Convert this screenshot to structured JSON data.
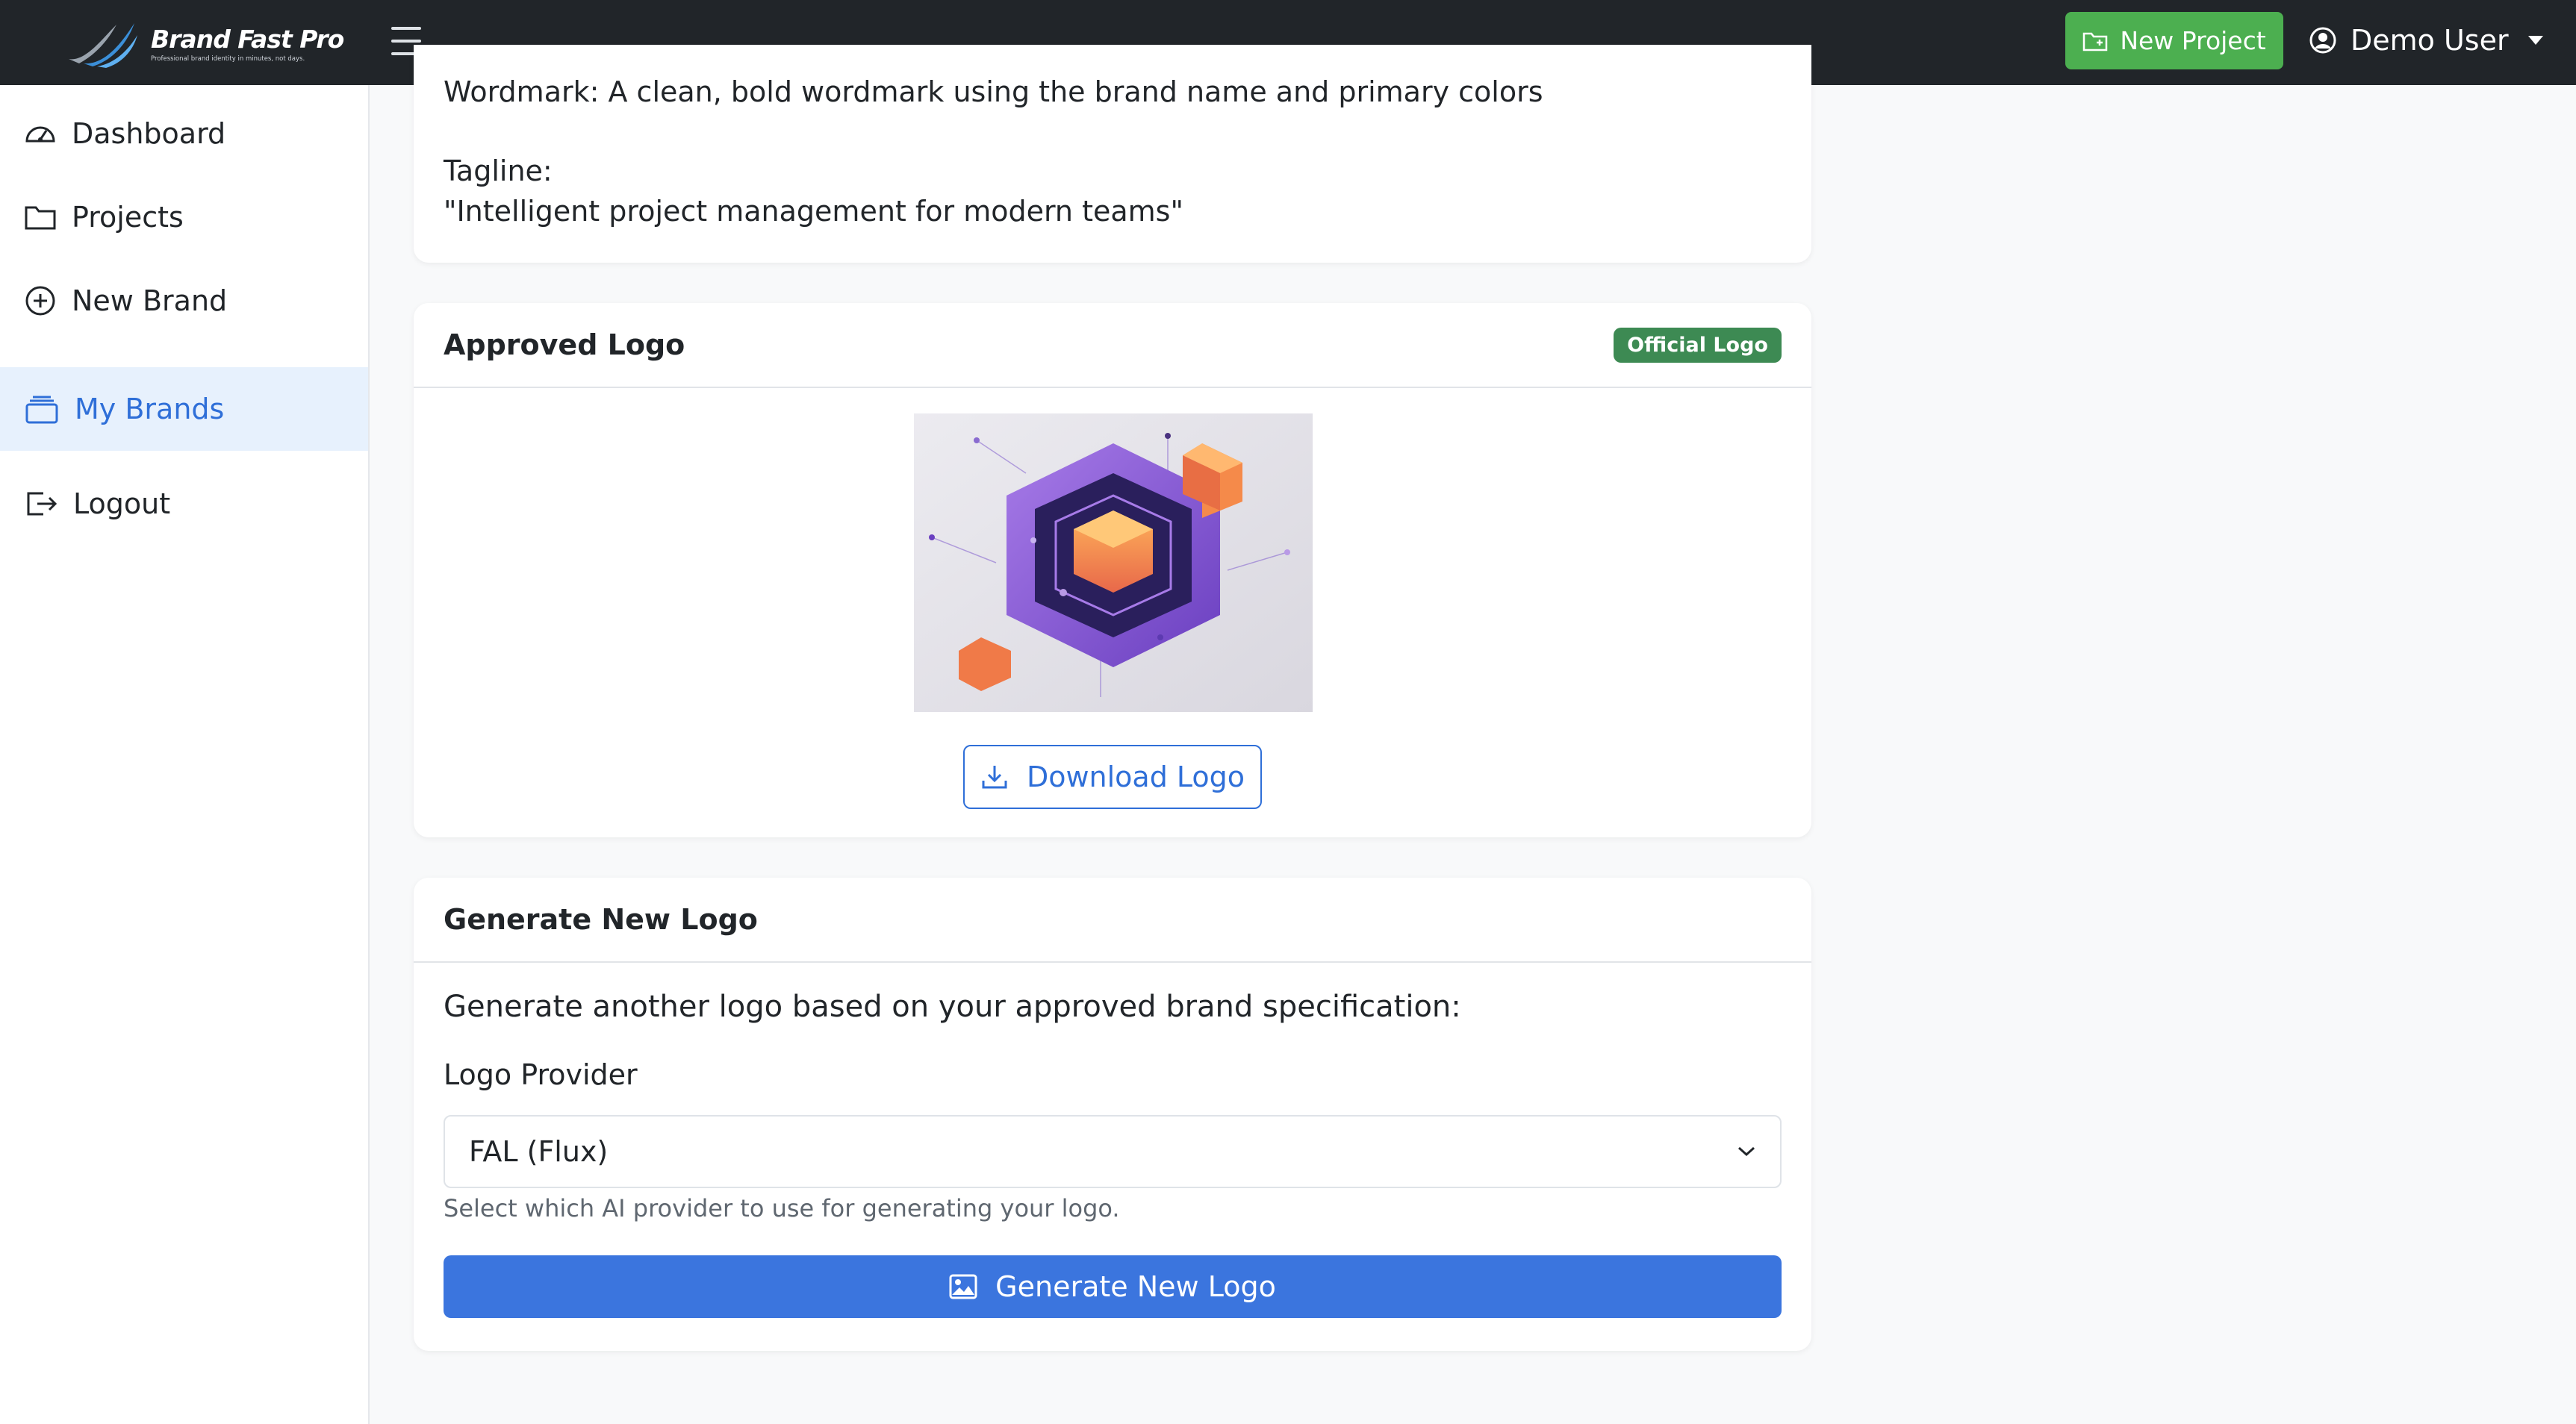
{
  "app": {
    "brand_name": "Brand Fast Pro",
    "brand_tagline": "Professional brand identity in minutes, not days."
  },
  "header": {
    "new_project_label": "New Project",
    "user_name": "Demo User",
    "new_project_color": "#4caf50"
  },
  "sidebar": {
    "items": [
      {
        "label": "Dashboard",
        "icon": "speedometer-icon"
      },
      {
        "label": "Projects",
        "icon": "folder-icon"
      },
      {
        "label": "New Brand",
        "icon": "plus-circle-icon"
      },
      {
        "label": "My Brands",
        "icon": "collection-icon",
        "active": true
      },
      {
        "label": "Logout",
        "icon": "logout-icon"
      }
    ]
  },
  "spec_card": {
    "wordmark_line": "Wordmark: A clean, bold wordmark using the brand name and primary colors",
    "tagline_label": "Tagline:",
    "tagline_value": "\"Intelligent project management for modern teams\""
  },
  "approved_logo": {
    "title": "Approved Logo",
    "badge": "Official Logo",
    "download_label": "Download Logo"
  },
  "generate": {
    "title": "Generate New Logo",
    "intro": "Generate another logo based on your approved brand specification:",
    "provider_label": "Logo Provider",
    "provider_selected": "FAL (Flux)",
    "help_text": "Select which AI provider to use for generating your logo.",
    "button_label": "Generate New Logo",
    "accent_color": "#3b75de"
  }
}
